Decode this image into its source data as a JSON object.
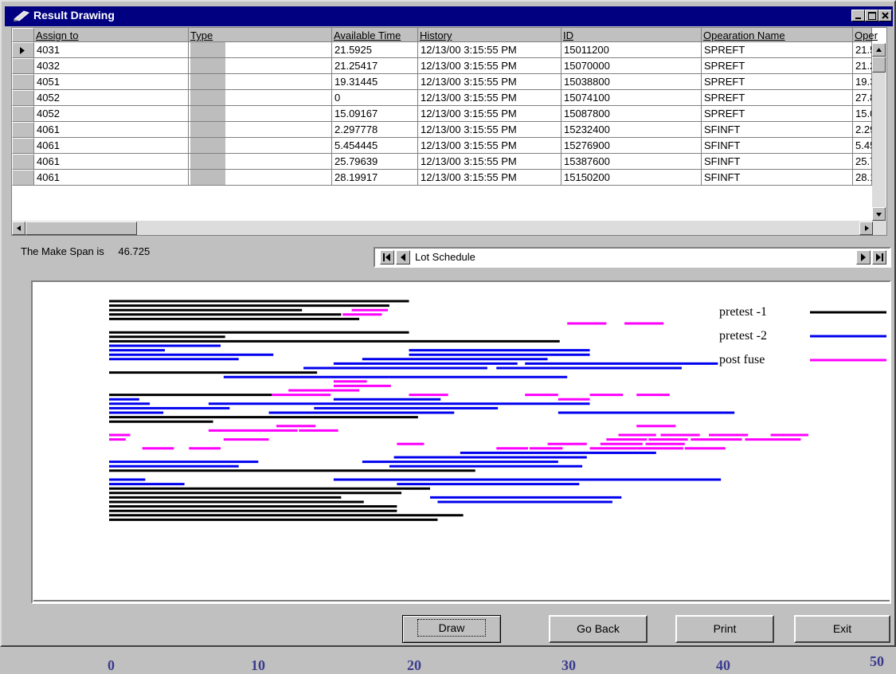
{
  "window": {
    "title": "Result Drawing"
  },
  "grid": {
    "columns": [
      "Assign  to",
      "Type",
      "Available Time",
      "History",
      "ID",
      "Opearation Name",
      "Oper"
    ],
    "rows": [
      [
        "4031",
        "",
        "21.5925",
        "12/13/00 3:15:55 PM",
        "15011200",
        "SPREFT",
        "21.5"
      ],
      [
        "4032",
        "",
        "21.25417",
        "12/13/00 3:15:55 PM",
        "15070000",
        "SPREFT",
        "21.2"
      ],
      [
        "4051",
        "",
        "19.31445",
        "12/13/00 3:15:55 PM",
        "15038800",
        "SPREFT",
        "19.3"
      ],
      [
        "4052",
        "",
        "0",
        "12/13/00 3:15:55 PM",
        "15074100",
        "SPREFT",
        "27.8"
      ],
      [
        "4052",
        "",
        "15.09167",
        "12/13/00 3:15:55 PM",
        "15087800",
        "SPREFT",
        "15.0"
      ],
      [
        "4061",
        "",
        "2.297778",
        "12/13/00 3:15:55 PM",
        "15232400",
        "SFINFT",
        "2.29"
      ],
      [
        "4061",
        "",
        "5.454445",
        "12/13/00 3:15:55 PM",
        "15276900",
        "SFINFT",
        "5.45"
      ],
      [
        "4061",
        "",
        "25.79639",
        "12/13/00 3:15:55 PM",
        "15387600",
        "SFINFT",
        "25.7"
      ],
      [
        "4061",
        "",
        "28.19917",
        "12/13/00 3:15:55 PM",
        "15150200",
        "SFINFT",
        "28.1"
      ]
    ]
  },
  "makespan": {
    "label": "The Make Span is",
    "value": "46.725"
  },
  "navigator": {
    "caption": "Lot Schedule"
  },
  "buttons": {
    "draw": "Draw",
    "go_back": "Go Back",
    "print": "Print",
    "exit": "Exit"
  },
  "colors": {
    "pretest1": "#000000",
    "pretest2": "#0000ee",
    "postfuse": "#ff00ff"
  },
  "chart_data": {
    "type": "gantt",
    "xticks": [
      "0",
      "10",
      "20",
      "30",
      "40",
      "50"
    ],
    "xlim": [
      0,
      50
    ],
    "legend": [
      {
        "name": "pretest -1",
        "color": "#000000"
      },
      {
        "name": "pretest -2",
        "color": "#0000ee"
      },
      {
        "name": "post fuse",
        "color": "#ff00ff"
      }
    ],
    "bars": [
      {
        "row": 0,
        "start": 0,
        "end": 19.9,
        "s": 0
      },
      {
        "row": 1,
        "start": 0,
        "end": 18.6,
        "s": 0
      },
      {
        "row": 2,
        "start": 0,
        "end": 12.8,
        "s": 0
      },
      {
        "row": 2,
        "start": 16.1,
        "end": 18.5,
        "s": 2
      },
      {
        "row": 3,
        "start": 0,
        "end": 15.4,
        "s": 0
      },
      {
        "row": 3,
        "start": 15.5,
        "end": 18.1,
        "s": 2
      },
      {
        "row": 4,
        "start": 0,
        "end": 16.6,
        "s": 0
      },
      {
        "row": 5,
        "start": 30.4,
        "end": 33.0,
        "s": 2
      },
      {
        "row": 5,
        "start": 34.2,
        "end": 36.8,
        "s": 2
      },
      {
        "row": 7,
        "start": 0,
        "end": 19.9,
        "s": 0
      },
      {
        "row": 8,
        "start": 0,
        "end": 7.7,
        "s": 0
      },
      {
        "row": 9,
        "start": 0,
        "end": 29.9,
        "s": 0
      },
      {
        "row": 10,
        "start": 0,
        "end": 7.4,
        "s": 1
      },
      {
        "row": 11,
        "start": 0,
        "end": 3.7,
        "s": 1
      },
      {
        "row": 11,
        "start": 19.9,
        "end": 31.9,
        "s": 1
      },
      {
        "row": 12,
        "start": 0,
        "end": 10.9,
        "s": 1
      },
      {
        "row": 12,
        "start": 19.9,
        "end": 31.9,
        "s": 1
      },
      {
        "row": 13,
        "start": 0,
        "end": 8.6,
        "s": 1
      },
      {
        "row": 13,
        "start": 16.8,
        "end": 29.1,
        "s": 1
      },
      {
        "row": 14,
        "start": 14.9,
        "end": 27.1,
        "s": 1
      },
      {
        "row": 14,
        "start": 27.6,
        "end": 40.4,
        "s": 1
      },
      {
        "row": 15,
        "start": 12.9,
        "end": 25.1,
        "s": 1
      },
      {
        "row": 15,
        "start": 25.7,
        "end": 38.0,
        "s": 1
      },
      {
        "row": 16,
        "start": 0,
        "end": 13.8,
        "s": 0
      },
      {
        "row": 17,
        "start": 7.6,
        "end": 18.6,
        "s": 1
      },
      {
        "row": 17,
        "start": 18.6,
        "end": 30.4,
        "s": 1
      },
      {
        "row": 18,
        "start": 14.9,
        "end": 17.1,
        "s": 2
      },
      {
        "row": 19,
        "start": 14.9,
        "end": 18.7,
        "s": 2
      },
      {
        "row": 20,
        "start": 11.9,
        "end": 16.6,
        "s": 2
      },
      {
        "row": 21,
        "start": 0,
        "end": 10.8,
        "s": 0
      },
      {
        "row": 21,
        "start": 10.8,
        "end": 14.7,
        "s": 2
      },
      {
        "row": 21,
        "start": 19.9,
        "end": 22.5,
        "s": 2
      },
      {
        "row": 21,
        "start": 27.6,
        "end": 29.8,
        "s": 2
      },
      {
        "row": 21,
        "start": 31.9,
        "end": 34.1,
        "s": 2
      },
      {
        "row": 21,
        "start": 35.0,
        "end": 37.2,
        "s": 2
      },
      {
        "row": 22,
        "start": 0,
        "end": 2.0,
        "s": 1
      },
      {
        "row": 22,
        "start": 14.9,
        "end": 22.0,
        "s": 1
      },
      {
        "row": 22,
        "start": 29.8,
        "end": 31.9,
        "s": 2
      },
      {
        "row": 23,
        "start": 0,
        "end": 2.7,
        "s": 1
      },
      {
        "row": 23,
        "start": 6.6,
        "end": 19.9,
        "s": 1
      },
      {
        "row": 23,
        "start": 19.9,
        "end": 31.9,
        "s": 1
      },
      {
        "row": 24,
        "start": 0,
        "end": 8.0,
        "s": 1
      },
      {
        "row": 24,
        "start": 13.6,
        "end": 25.8,
        "s": 1
      },
      {
        "row": 25,
        "start": 0,
        "end": 3.6,
        "s": 1
      },
      {
        "row": 25,
        "start": 10.6,
        "end": 22.9,
        "s": 1
      },
      {
        "row": 25,
        "start": 29.8,
        "end": 41.5,
        "s": 1
      },
      {
        "row": 26,
        "start": 0,
        "end": 20.5,
        "s": 0
      },
      {
        "row": 27,
        "start": 0,
        "end": 6.9,
        "s": 0
      },
      {
        "row": 28,
        "start": 11.1,
        "end": 13.7,
        "s": 2
      },
      {
        "row": 28,
        "start": 35.0,
        "end": 37.6,
        "s": 2
      },
      {
        "row": 29,
        "start": 6.6,
        "end": 12.5,
        "s": 2
      },
      {
        "row": 29,
        "start": 12.6,
        "end": 15.2,
        "s": 2
      },
      {
        "row": 30,
        "start": 0,
        "end": 1.4,
        "s": 2
      },
      {
        "row": 30,
        "start": 33.8,
        "end": 36.3,
        "s": 2
      },
      {
        "row": 30,
        "start": 36.6,
        "end": 39.2,
        "s": 2
      },
      {
        "row": 30,
        "start": 39.8,
        "end": 42.4,
        "s": 2
      },
      {
        "row": 30,
        "start": 43.9,
        "end": 46.4,
        "s": 2
      },
      {
        "row": 31,
        "start": 0,
        "end": 1.1,
        "s": 2
      },
      {
        "row": 31,
        "start": 7.6,
        "end": 10.6,
        "s": 2
      },
      {
        "row": 31,
        "start": 33.0,
        "end": 35.7,
        "s": 2
      },
      {
        "row": 31,
        "start": 35.8,
        "end": 38.4,
        "s": 2
      },
      {
        "row": 31,
        "start": 38.6,
        "end": 42.0,
        "s": 2
      },
      {
        "row": 31,
        "start": 42.2,
        "end": 45.9,
        "s": 2
      },
      {
        "row": 32,
        "start": 19.1,
        "end": 20.9,
        "s": 2
      },
      {
        "row": 32,
        "start": 29.1,
        "end": 31.7,
        "s": 2
      },
      {
        "row": 32,
        "start": 32.6,
        "end": 35.4,
        "s": 2
      },
      {
        "row": 32,
        "start": 35.6,
        "end": 38.2,
        "s": 2
      },
      {
        "row": 33,
        "start": 2.2,
        "end": 4.3,
        "s": 2
      },
      {
        "row": 33,
        "start": 5.3,
        "end": 7.4,
        "s": 2
      },
      {
        "row": 33,
        "start": 25.7,
        "end": 27.8,
        "s": 2
      },
      {
        "row": 33,
        "start": 27.9,
        "end": 30.1,
        "s": 2
      },
      {
        "row": 33,
        "start": 31.9,
        "end": 35.0,
        "s": 2
      },
      {
        "row": 33,
        "start": 35.0,
        "end": 38.1,
        "s": 2
      },
      {
        "row": 33,
        "start": 38.2,
        "end": 40.9,
        "s": 2
      },
      {
        "row": 34,
        "start": 23.3,
        "end": 36.3,
        "s": 1
      },
      {
        "row": 35,
        "start": 18.9,
        "end": 31.7,
        "s": 1
      },
      {
        "row": 36,
        "start": 0,
        "end": 9.9,
        "s": 1
      },
      {
        "row": 36,
        "start": 16.8,
        "end": 29.8,
        "s": 1
      },
      {
        "row": 37,
        "start": 0,
        "end": 8.6,
        "s": 1
      },
      {
        "row": 37,
        "start": 18.6,
        "end": 31.4,
        "s": 1
      },
      {
        "row": 38,
        "start": 0,
        "end": 24.3,
        "s": 0
      },
      {
        "row": 40,
        "start": 0,
        "end": 2.4,
        "s": 1
      },
      {
        "row": 40,
        "start": 14.9,
        "end": 40.6,
        "s": 1
      },
      {
        "row": 41,
        "start": 0,
        "end": 5.0,
        "s": 1
      },
      {
        "row": 41,
        "start": 19.1,
        "end": 31.2,
        "s": 1
      },
      {
        "row": 42,
        "start": 0,
        "end": 21.3,
        "s": 0
      },
      {
        "row": 43,
        "start": 0,
        "end": 19.4,
        "s": 0
      },
      {
        "row": 44,
        "start": 0,
        "end": 15.4,
        "s": 0
      },
      {
        "row": 44,
        "start": 21.3,
        "end": 34.0,
        "s": 1
      },
      {
        "row": 45,
        "start": 0,
        "end": 16.9,
        "s": 0
      },
      {
        "row": 45,
        "start": 21.8,
        "end": 33.4,
        "s": 1
      },
      {
        "row": 46,
        "start": 0,
        "end": 19.1,
        "s": 0
      },
      {
        "row": 47,
        "start": 0,
        "end": 19.1,
        "s": 0
      },
      {
        "row": 48,
        "start": 0,
        "end": 23.5,
        "s": 0
      },
      {
        "row": 49,
        "start": 0,
        "end": 21.8,
        "s": 0
      }
    ]
  }
}
